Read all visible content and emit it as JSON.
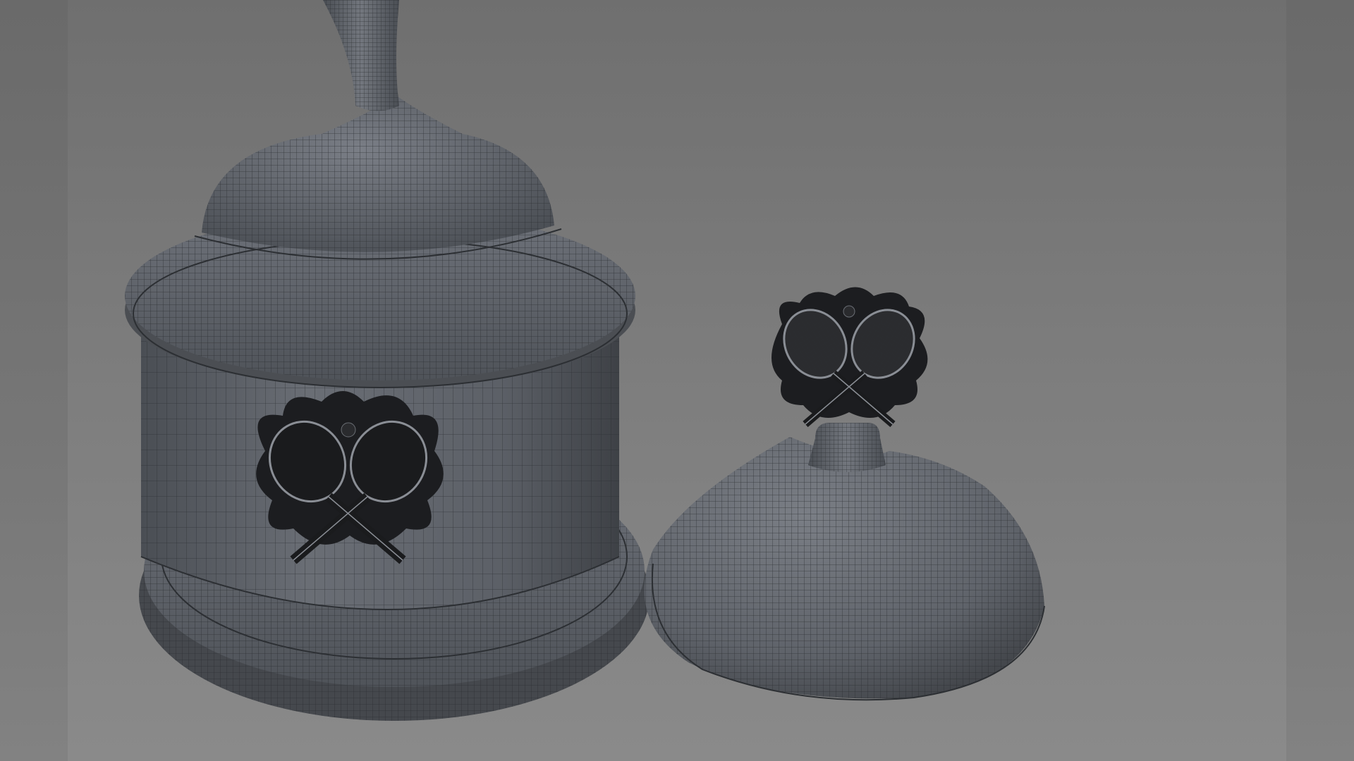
{
  "viewport": {
    "background_top": "#6f6f6f",
    "background_bottom": "#8a8a8a",
    "side_band_color": "#747474"
  },
  "objects": {
    "trophy_base": {
      "name": "trophy-base",
      "mesh_color": "#5d6168",
      "wire_color": "#2c2f33",
      "emblem": "crossed-tennis-rackets-emblem"
    },
    "trophy_lid": {
      "name": "trophy-lid",
      "mesh_color": "#5f636a",
      "wire_color": "#2c2f33",
      "emblem": "crossed-tennis-rackets-emblem"
    }
  }
}
